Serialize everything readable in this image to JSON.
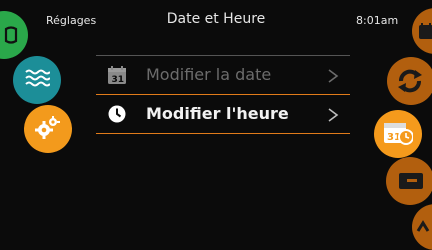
{
  "header": {
    "back_label": "Réglages",
    "title": "Date et Heure",
    "time": "8:01am"
  },
  "menu": {
    "items": [
      {
        "label": "Modifier la date",
        "icon": "calendar-icon",
        "state": "disabled"
      },
      {
        "label": "Modifier l'heure",
        "icon": "clock-icon",
        "state": "active"
      }
    ]
  },
  "left_nav": {
    "items": [
      {
        "name": "home",
        "icon": "home-icon",
        "color": "#2aa84a"
      },
      {
        "name": "water",
        "icon": "water-waves-icon",
        "color": "#1c8e98"
      },
      {
        "name": "settings",
        "icon": "gears-icon",
        "color": "#f39a1c"
      }
    ]
  },
  "right_nav": {
    "items": [
      {
        "name": "date-time",
        "icon": "calendar-clock-icon",
        "color": "#f59a1c",
        "selected": true
      }
    ]
  },
  "colors": {
    "accent": "#e07b1a",
    "teal": "#1c8e98",
    "green": "#2aa84a",
    "dim_orange": "#b25f0e"
  }
}
